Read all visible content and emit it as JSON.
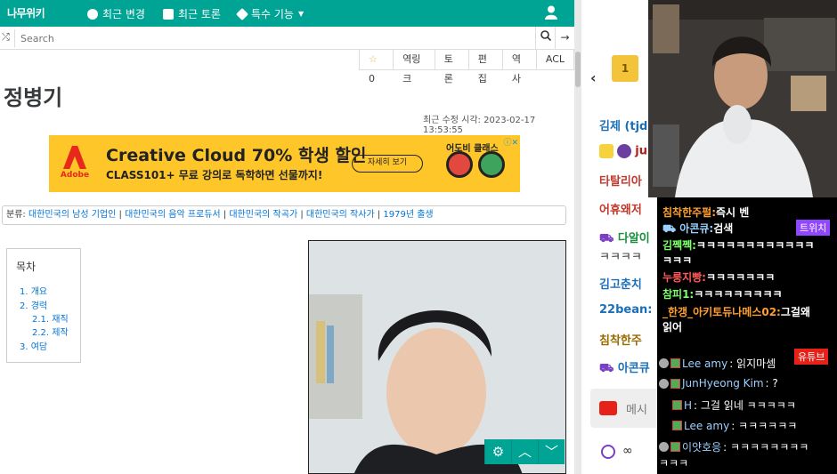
{
  "nav": {
    "logo": "나무위키",
    "recent_changes": "최근 변경",
    "recent_discuss": "최근 토론",
    "special": "특수 기능"
  },
  "search": {
    "placeholder": "Search"
  },
  "toolbar": {
    "star_count": "0",
    "backlinks": "역링크",
    "discuss": "토론",
    "edit": "편집",
    "history": "역사",
    "acl": "ACL"
  },
  "page": {
    "title": "정병기",
    "modified": "최근 수정 시각: 2023-02-17 13:53:55"
  },
  "ad": {
    "adobe": "Adobe",
    "headline": "Creative Cloud 70% 학생 할인",
    "sub": "CLASS101+ 무료 강의로 독학하면 선물까지!",
    "button": "자세히 보기",
    "brand": "어도비 클래스"
  },
  "categories": {
    "label": "분류:",
    "items": [
      "대한민국의 남성 기업인",
      "대한민국의 음악 프로듀서",
      "대한민국의 작곡가",
      "대한민국의 작사가",
      "1979년 출생"
    ]
  },
  "toc": {
    "heading": "목차",
    "items": [
      {
        "num": "1.",
        "label": "개요"
      },
      {
        "num": "2.",
        "label": "경력"
      },
      {
        "num": "2.1.",
        "label": "재직"
      },
      {
        "num": "2.2.",
        "label": "제작"
      },
      {
        "num": "3.",
        "label": "여담"
      }
    ]
  },
  "right_chat": [
    {
      "text": "김제 (tjdo",
      "color": "#1a6fb8"
    },
    {
      "text": "ju",
      "color": "#b02020"
    },
    {
      "text": "타탈리아",
      "color": "#c0392b"
    },
    {
      "text": "어휴왜저",
      "color": "#c0392b"
    },
    {
      "text": "다알이",
      "color": "#1a8f3a"
    },
    {
      "text": "ㅋㅋㅋㅋ",
      "color": "#333"
    },
    {
      "text": "김고춘치",
      "color": "#1a6fb8"
    },
    {
      "text": "22bean:",
      "color": "#1a6fb8"
    },
    {
      "text": "침착한주",
      "color": "#9a6b00"
    },
    {
      "text": "아콘큐",
      "color": "#1a6fb8"
    },
    {
      "text": "메시",
      "color": "#777"
    },
    {
      "text": "∞",
      "color": "#333"
    }
  ],
  "twitch_label": "트위치",
  "youtube_label": "유튜브",
  "twitch_chat": [
    {
      "user": "침착한주펄:",
      "msg": "즉시 벤",
      "color": "#ff9f2e"
    },
    {
      "user": "아콘큐:",
      "msg": "검색",
      "color": "#9bd0ff"
    },
    {
      "user": "김쩩쩩:",
      "msg": "ㅋㅋㅋㅋㅋㅋㅋㅋㅋㅋㅋㅋ",
      "color": "#7cff6b"
    },
    {
      "user": "",
      "msg": "ㅋㅋㅋ",
      "color": "#fff"
    },
    {
      "user": "누룽지빵:",
      "msg": "ㅋㅋㅋㅋㅋㅋㅋ",
      "color": "#ff5a5a"
    },
    {
      "user": "참피1:",
      "msg": "ㅋㅋㅋㅋㅋㅋㅋㅋㅋ",
      "color": "#7cff6b"
    },
    {
      "user": "_한갱_아키토듀나메스02:",
      "msg": "그걸왜",
      "color": "#ff9f2e"
    },
    {
      "user": "",
      "msg": "읽어",
      "color": "#fff"
    }
  ],
  "youtube_chat": [
    {
      "user": "Lee amy",
      "msg": ": 읽지마셈",
      "color": "#9bd0ff"
    },
    {
      "user": "JunHyeong Kim",
      "msg": ": ?",
      "color": "#9bd0ff"
    },
    {
      "user": "H",
      "msg": ": 그걸 읽네 ㅋㅋㅋㅋㅋ",
      "color": "#9bd0ff"
    },
    {
      "user": "Lee amy",
      "msg": ": ㅋㅋㅋㅋㅋㅋ",
      "color": "#9bd0ff"
    },
    {
      "user": "이얏호응",
      "msg": ": ㅋㅋㅋㅋㅋㅋㅋㅋ",
      "color": "#9bd0ff"
    },
    {
      "user": "",
      "msg": "ㅋㅋㅋ",
      "color": "#fff"
    }
  ],
  "colors": {
    "namu_green": "#00a495",
    "link": "#0275d8",
    "ad_bg": "#ffc629"
  }
}
